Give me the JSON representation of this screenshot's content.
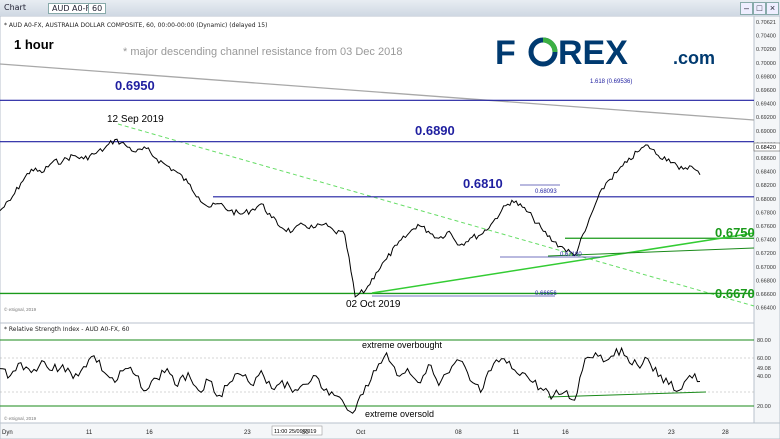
{
  "window": {
    "title": "Chart",
    "symbol_field": "AUD A0-FX",
    "interval_field": "60",
    "header": "* AUD A0-FX, AUSTRALIA DOLLAR COMPOSITE, 60, 00:00-00:00 (Dynamic) (delayed 15)",
    "rsi_header": "* Relative Strength Index - AUD A0-FX, 60",
    "copyright_price": "© eSignal, 2019",
    "copyright_rsi": "© eSignal, 2019"
  },
  "brand": {
    "logo_text": "FOREX.com",
    "logo_main": "F",
    "logo_o": "O",
    "logo_rest": "REX",
    "logo_suffix": ".com"
  },
  "annotations": {
    "timeframe": "1 hour",
    "note": "* major descending channel resistance from 03 Dec 2018",
    "high_label": "12 Sep 2019",
    "low_label": "02 Oct 2019",
    "fib_label": "1.618 (0.69536)",
    "swing_1": "0.68093",
    "swing_2": "0.67180",
    "low_price": "0.66656",
    "rsi_overbought": "extreme overbought",
    "rsi_oversold": "extreme oversold"
  },
  "colors": {
    "resistance": "#1f1fa0",
    "support": "#1a9a1a",
    "channel": "#9a9a9a",
    "price": "#000000",
    "dashed": "#55dd55"
  },
  "chart_data": {
    "type": "line",
    "title": "AUD A0-FX, AUSTRALIA DOLLAR COMPOSITE, 60",
    "ylim": [
      0.663,
      0.7065
    ],
    "x_ticks": [
      "11",
      "16",
      "23",
      "30",
      "Oct",
      "08",
      "11",
      "16",
      "23",
      "28"
    ],
    "y_ticks": [
      "0.70621",
      "0.70400",
      "0.70200",
      "0.70000",
      "0.69800",
      "0.69600",
      "0.69400",
      "0.69200",
      "0.69000",
      "0.68800",
      "0.68600",
      "0.68400",
      "0.68200",
      "0.68000",
      "0.67800",
      "0.67600",
      "0.67400",
      "0.67200",
      "0.67000",
      "0.66800",
      "0.66600",
      "0.66400"
    ],
    "current_price": "0.68420",
    "time_stamp": "11:00 25/09/2019",
    "x_axis_left": "Dyn",
    "levels": [
      {
        "name": "0.6950",
        "value": 0.695,
        "kind": "resistance"
      },
      {
        "name": "0.6890",
        "value": 0.689,
        "kind": "resistance"
      },
      {
        "name": "0.6810",
        "value": 0.681,
        "kind": "resistance"
      },
      {
        "name": "0.6750",
        "value": 0.675,
        "kind": "support"
      },
      {
        "name": "0.6670",
        "value": 0.667,
        "kind": "support"
      }
    ],
    "series": [
      {
        "name": "AUD A0-FX",
        "values": [
          0.679,
          0.6805,
          0.683,
          0.685,
          0.6845,
          0.686,
          0.6862,
          0.687,
          0.6865,
          0.6872,
          0.688,
          0.6893,
          0.6885,
          0.6875,
          0.688,
          0.6865,
          0.6855,
          0.6845,
          0.683,
          0.681,
          0.6795,
          0.68,
          0.679,
          0.6785,
          0.679,
          0.68,
          0.678,
          0.6765,
          0.676,
          0.677,
          0.6765,
          0.677,
          0.676,
          0.6755,
          0.6665,
          0.6675,
          0.67,
          0.672,
          0.674,
          0.6755,
          0.677,
          0.676,
          0.675,
          0.676,
          0.674,
          0.675,
          0.6755,
          0.677,
          0.679,
          0.6805,
          0.6795,
          0.678,
          0.676,
          0.6745,
          0.6735,
          0.6725,
          0.676,
          0.68,
          0.683,
          0.6845,
          0.686,
          0.6875,
          0.6885,
          0.687,
          0.6865,
          0.685,
          0.6855,
          0.6842
        ]
      },
      {
        "name": "RSI",
        "values": [
          62,
          55,
          68,
          58,
          70,
          60,
          66,
          52,
          64,
          75,
          58,
          48,
          62,
          55,
          40,
          52,
          62,
          44,
          58,
          40,
          50,
          35,
          48,
          56,
          46,
          60,
          42,
          50,
          38,
          46,
          55,
          40,
          35,
          25,
          20,
          45,
          60,
          78,
          55,
          62,
          48,
          66,
          45,
          58,
          70,
          50,
          38,
          60,
          72,
          62,
          58,
          48,
          40,
          35,
          38,
          30,
          72,
          78,
          70,
          82,
          74,
          66,
          72,
          54,
          46,
          40,
          55,
          49
        ]
      }
    ],
    "rsi_ylim": [
      10,
      95
    ],
    "rsi_levels": [
      80,
      20
    ],
    "rsi_ticks": [
      "80.00",
      "60.00",
      "49.08",
      "40.00",
      "20.00"
    ]
  }
}
